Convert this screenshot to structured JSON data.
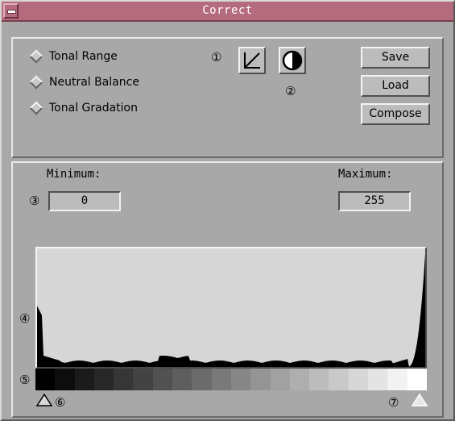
{
  "window": {
    "title": "Correct"
  },
  "modes": [
    {
      "label": "Tonal Range"
    },
    {
      "label": "Neutral Balance"
    },
    {
      "label": "Tonal Gradation"
    }
  ],
  "callouts": [
    "①",
    "②",
    "③",
    "④",
    "⑤",
    "⑥",
    "⑦"
  ],
  "icons": {
    "curve": "curve-icon",
    "contrast": "half-circle-contrast-icon"
  },
  "buttons": {
    "save": "Save",
    "load": "Load",
    "compose": "Compose"
  },
  "range": {
    "min_label": "Minimum:",
    "min_value": "0",
    "max_label": "Maximum:",
    "max_value": "255"
  },
  "gradient_steps": 20,
  "colors": {
    "titlebar": "#b56b7e",
    "panel": "#a8a8a8",
    "histogram_bg": "#d6d6d6"
  }
}
